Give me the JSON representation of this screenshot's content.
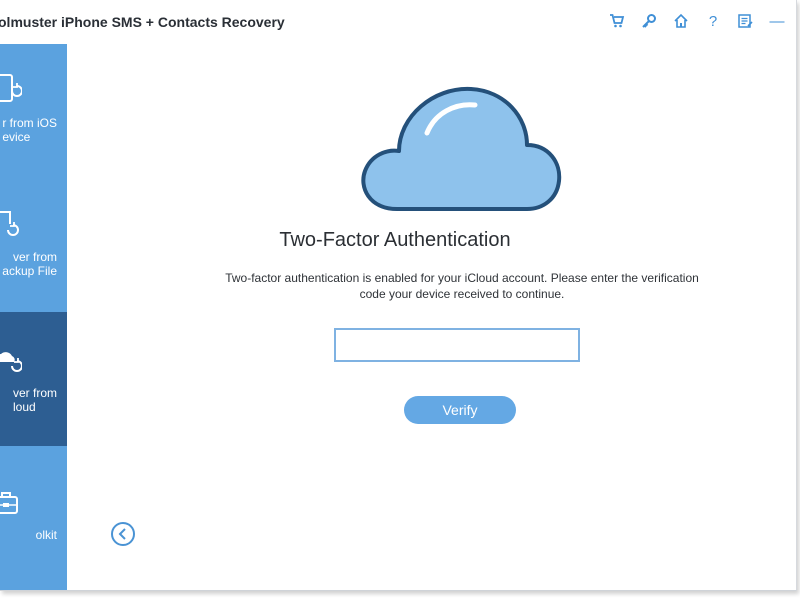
{
  "app": {
    "title": "olmuster iPhone SMS + Contacts Recovery"
  },
  "toolbar": {
    "icons": [
      "cart-icon",
      "key-icon",
      "home-icon",
      "help-icon",
      "feedback-icon",
      "minimize-icon"
    ],
    "help_glyph": "?",
    "minimize_glyph": "—",
    "accent": "#3f8fd6"
  },
  "sidebar": {
    "background": "#5ba2df",
    "active_background": "#2d5e92",
    "items": [
      {
        "line1": "r from iOS",
        "line2": "evice",
        "icon": "phone-recover-icon",
        "active": false
      },
      {
        "line1": "ver from",
        "line2": "ackup File",
        "icon": "backup-file-icon",
        "active": false
      },
      {
        "line1": "ver from",
        "line2": "loud",
        "icon": "cloud-recover-icon",
        "active": true
      },
      {
        "line1": "olkit",
        "line2": "",
        "icon": "toolbox-icon",
        "active": false
      }
    ]
  },
  "main": {
    "icon": "cloud-icon",
    "heading": "Two-Factor Authentication",
    "description_line1": "Two-factor authentication is enabled for your iCloud account. Please enter the verification",
    "description_line2": "code your device received to continue.",
    "code_input": {
      "value": "",
      "placeholder": ""
    },
    "verify_label": "Verify",
    "back_icon": "back-arrow-icon"
  }
}
